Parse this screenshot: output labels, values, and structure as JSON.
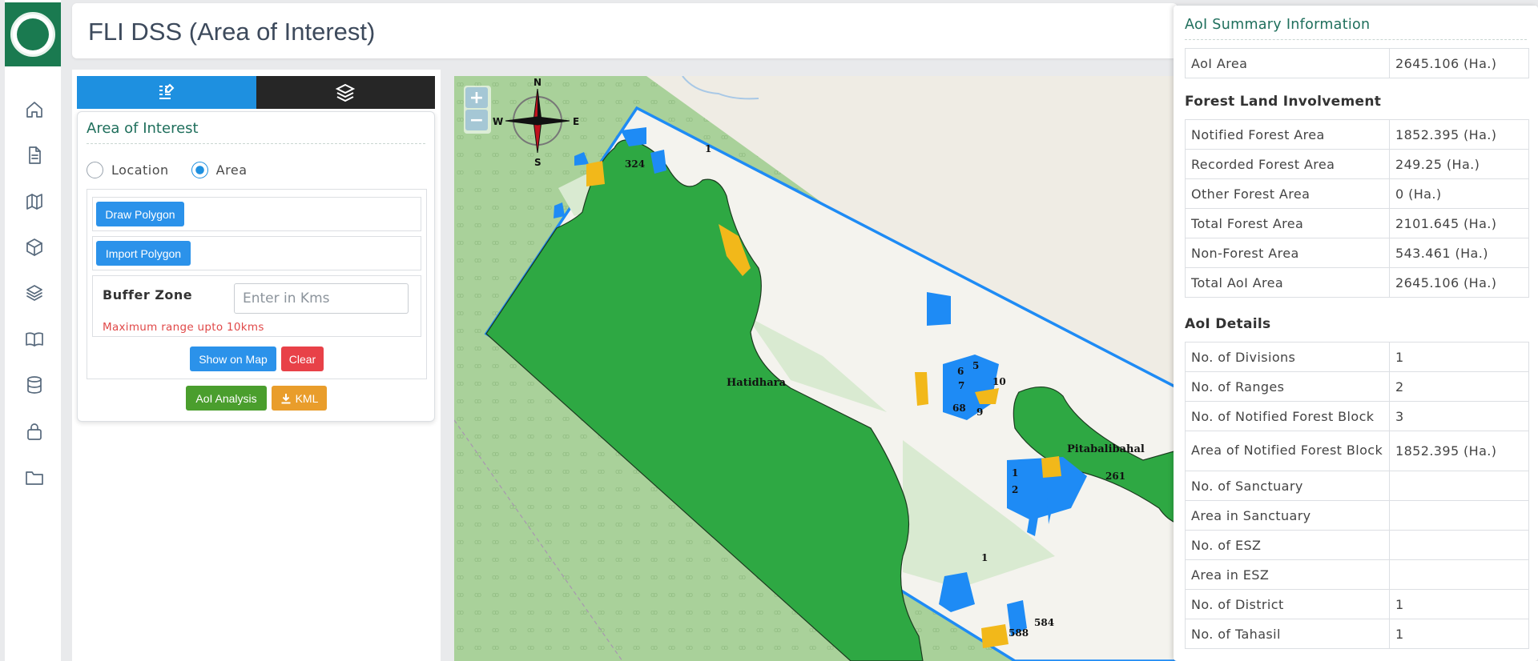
{
  "app": {
    "title": "FLI DSS (Area of Interest)"
  },
  "sidebar": {
    "icons": [
      "home-icon",
      "document-icon",
      "map-icon",
      "cube-icon",
      "layers-icon",
      "book-icon",
      "database-icon",
      "lock-icon",
      "folder-icon"
    ]
  },
  "panel": {
    "tabs": [
      {
        "icon": "list-edit-icon",
        "active": true
      },
      {
        "icon": "layers-icon",
        "active": false
      }
    ],
    "title": "Area of Interest",
    "radio": {
      "location_label": "Location",
      "area_label": "Area",
      "selected": "Area"
    },
    "draw_polygon": "Draw Polygon",
    "import_polygon": "Import Polygon",
    "buffer": {
      "label": "Buffer Zone",
      "placeholder": "Enter in Kms",
      "note": "Maximum range upto 10kms"
    },
    "show_on_map": "Show on Map",
    "clear": "Clear",
    "aoi_analysis": "AoI Analysis",
    "kml": "KML"
  },
  "map": {
    "zoom_in": "+",
    "zoom_out": "−",
    "compass": {
      "n": "N",
      "s": "S",
      "e": "E",
      "w": "W"
    },
    "labels": {
      "hatidhara": "Hatidhara",
      "pitabalibahal": "Pitabalibahal",
      "l324": "324",
      "l1a": "1",
      "l6": "6",
      "l5": "5",
      "l10": "10",
      "l7": "7",
      "l68": "68",
      "l9": "9",
      "l1b": "1",
      "l2": "2",
      "l261": "261",
      "l1c": "1",
      "l584": "584",
      "l588": "588"
    },
    "colors": {
      "forest": "#2ea843",
      "notified": "#1e8bf5",
      "recorded": "#f2b81a",
      "boundary": "#1e8bf5",
      "basemap": "#a9d19a"
    }
  },
  "summary": {
    "title": "AoI Summary Information",
    "aoi_area": {
      "label": "AoI Area",
      "value": "2645.106 (Ha.)"
    },
    "forest_section": "Forest Land Involvement",
    "forest_rows": [
      {
        "label": "Notified Forest Area",
        "value": "1852.395 (Ha.)"
      },
      {
        "label": "Recorded Forest Area",
        "value": "249.25 (Ha.)"
      },
      {
        "label": "Other Forest Area",
        "value": "0 (Ha.)"
      },
      {
        "label": "Total Forest Area",
        "value": "2101.645 (Ha.)"
      },
      {
        "label": "Non-Forest Area",
        "value": "543.461 (Ha.)"
      },
      {
        "label": "Total AoI Area",
        "value": "2645.106 (Ha.)"
      }
    ],
    "details_section": "AoI Details",
    "detail_rows": [
      {
        "label": "No. of Divisions",
        "value": "1"
      },
      {
        "label": "No. of Ranges",
        "value": "2"
      },
      {
        "label": "No. of Notified Forest Block",
        "value": "3"
      },
      {
        "label": "Area of Notified Forest Block",
        "value": "1852.395 (Ha.)"
      },
      {
        "label": "No. of Sanctuary",
        "value": ""
      },
      {
        "label": "Area in Sanctuary",
        "value": ""
      },
      {
        "label": "No. of ESZ",
        "value": ""
      },
      {
        "label": "Area in ESZ",
        "value": ""
      },
      {
        "label": "No. of District",
        "value": "1"
      },
      {
        "label": "No. of Tahasil",
        "value": "1"
      }
    ]
  }
}
